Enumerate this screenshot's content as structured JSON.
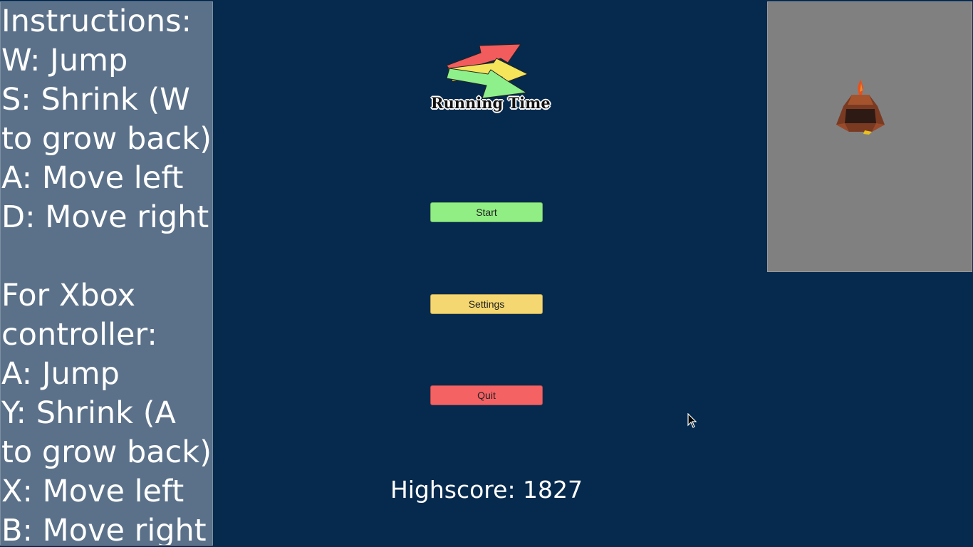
{
  "instructions": {
    "lines": [
      "Instructions:",
      "W: Jump",
      "S: Shrink (W",
      "to grow back)",
      "A: Move left",
      "D: Move right",
      "",
      "For Xbox",
      "controller:",
      "A: Jump",
      "Y: Shrink (A",
      "to grow back)",
      "X: Move left",
      "B: Move right"
    ]
  },
  "logo": {
    "text": "Running Time",
    "colors": {
      "red_arrow": "#f25c5c",
      "yellow_arrow": "#f5e55a",
      "green_arrow": "#8ef08a"
    }
  },
  "menu": {
    "start_label": "Start",
    "settings_label": "Settings",
    "quit_label": "Quit",
    "colors": {
      "start": "#90ee84",
      "settings": "#f4d770",
      "quit": "#f46264"
    }
  },
  "highscore": {
    "text": "Highscore: 1827"
  },
  "preview": {
    "model": "volcano-character"
  },
  "colors": {
    "background": "#062a4e",
    "panel": "#5b7189",
    "preview_bg": "#808080"
  },
  "cursor": "arrow-cursor-icon"
}
